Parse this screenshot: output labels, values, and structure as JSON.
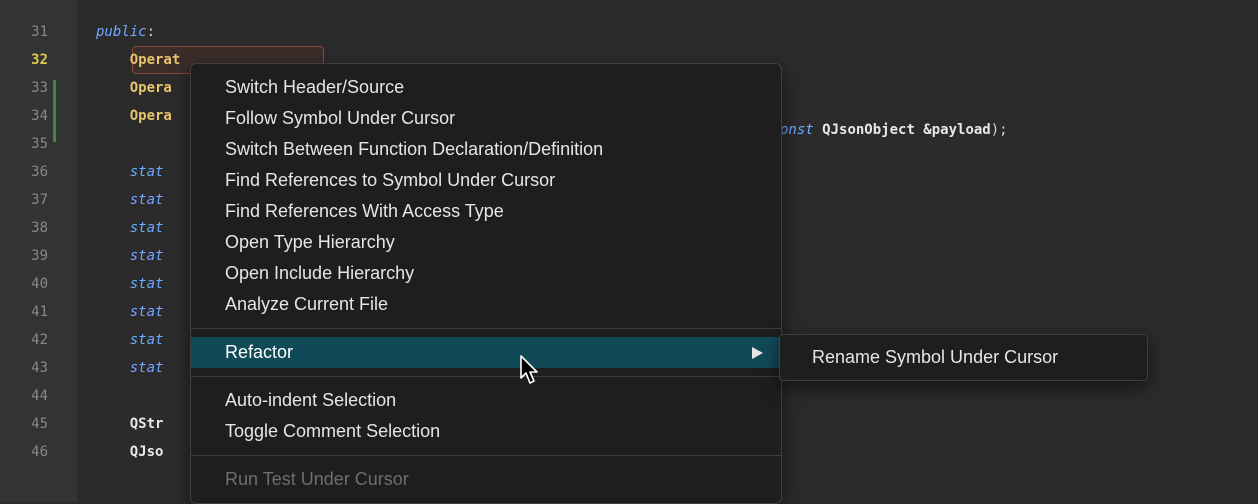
{
  "editor": {
    "lines": [
      {
        "num": "31",
        "segments": [
          {
            "text": "public",
            "cls": "kw"
          },
          {
            "text": ":",
            "cls": ""
          }
        ]
      },
      {
        "num": "32",
        "current": true,
        "segments": [
          {
            "text": "    ",
            "cls": ""
          },
          {
            "text": "Operat",
            "cls": "ident"
          }
        ]
      },
      {
        "num": "33",
        "segments": [
          {
            "text": "    ",
            "cls": ""
          },
          {
            "text": "Opera",
            "cls": "ident"
          }
        ]
      },
      {
        "num": "34",
        "segments": [
          {
            "text": "    ",
            "cls": ""
          },
          {
            "text": "Opera",
            "cls": "ident"
          }
        ]
      },
      {
        "num": "35",
        "segments": []
      },
      {
        "num": "36",
        "segments": [
          {
            "text": "    stat",
            "cls": "kw"
          }
        ]
      },
      {
        "num": "37",
        "segments": [
          {
            "text": "    stat",
            "cls": "kw"
          }
        ]
      },
      {
        "num": "38",
        "segments": [
          {
            "text": "    stat",
            "cls": "kw"
          }
        ]
      },
      {
        "num": "39",
        "segments": [
          {
            "text": "    stat",
            "cls": "kw"
          }
        ]
      },
      {
        "num": "40",
        "segments": [
          {
            "text": "    stat",
            "cls": "kw"
          }
        ]
      },
      {
        "num": "41",
        "segments": [
          {
            "text": "    stat",
            "cls": "kw"
          }
        ]
      },
      {
        "num": "42",
        "segments": [
          {
            "text": "    stat",
            "cls": "kw"
          }
        ]
      },
      {
        "num": "43",
        "segments": [
          {
            "text": "    stat",
            "cls": "kw"
          }
        ]
      },
      {
        "num": "44",
        "segments": []
      },
      {
        "num": "45",
        "segments": [
          {
            "text": "    ",
            "cls": ""
          },
          {
            "text": "QStr",
            "cls": "ptype"
          }
        ]
      },
      {
        "num": "46",
        "segments": [
          {
            "text": "    ",
            "cls": ""
          },
          {
            "text": "QJso",
            "cls": "ptype"
          }
        ]
      }
    ],
    "line34_tail": [
      {
        "text": "onst ",
        "cls": "kw"
      },
      {
        "text": "QJsonObject &payload",
        "cls": "ptype"
      },
      {
        "text": ");",
        "cls": ""
      }
    ]
  },
  "context_menu": {
    "items": [
      {
        "label": "Switch Header/Source",
        "name": "menu-item-switch-header-source"
      },
      {
        "label": "Follow Symbol Under Cursor",
        "name": "menu-item-follow-symbol"
      },
      {
        "label": "Switch Between Function Declaration/Definition",
        "name": "menu-item-switch-decl-def"
      },
      {
        "label": "Find References to Symbol Under Cursor",
        "name": "menu-item-find-references"
      },
      {
        "label": "Find References With Access Type",
        "name": "menu-item-find-references-access-type"
      },
      {
        "label": "Open Type Hierarchy",
        "name": "menu-item-open-type-hierarchy"
      },
      {
        "label": "Open Include Hierarchy",
        "name": "menu-item-open-include-hierarchy"
      },
      {
        "label": "Analyze Current File",
        "name": "menu-item-analyze-current-file"
      },
      {
        "separator": true
      },
      {
        "label": "Refactor",
        "name": "menu-item-refactor",
        "selected": true,
        "submenu": true
      },
      {
        "separator": true
      },
      {
        "label": "Auto-indent Selection",
        "name": "menu-item-auto-indent"
      },
      {
        "label": "Toggle Comment Selection",
        "name": "menu-item-toggle-comment"
      },
      {
        "separator": true
      },
      {
        "label": "Run Test Under Cursor",
        "name": "menu-item-run-test",
        "disabled": true
      }
    ]
  },
  "submenu": {
    "items": [
      {
        "label": "Rename Symbol Under Cursor",
        "name": "submenu-item-rename-symbol"
      }
    ]
  },
  "colors": {
    "editor_bg": "#2b2b2b",
    "menu_bg": "#1e1e1e",
    "selection": "#114a57",
    "keyword": "#6fa8ff",
    "identifier": "#e8c46a"
  }
}
